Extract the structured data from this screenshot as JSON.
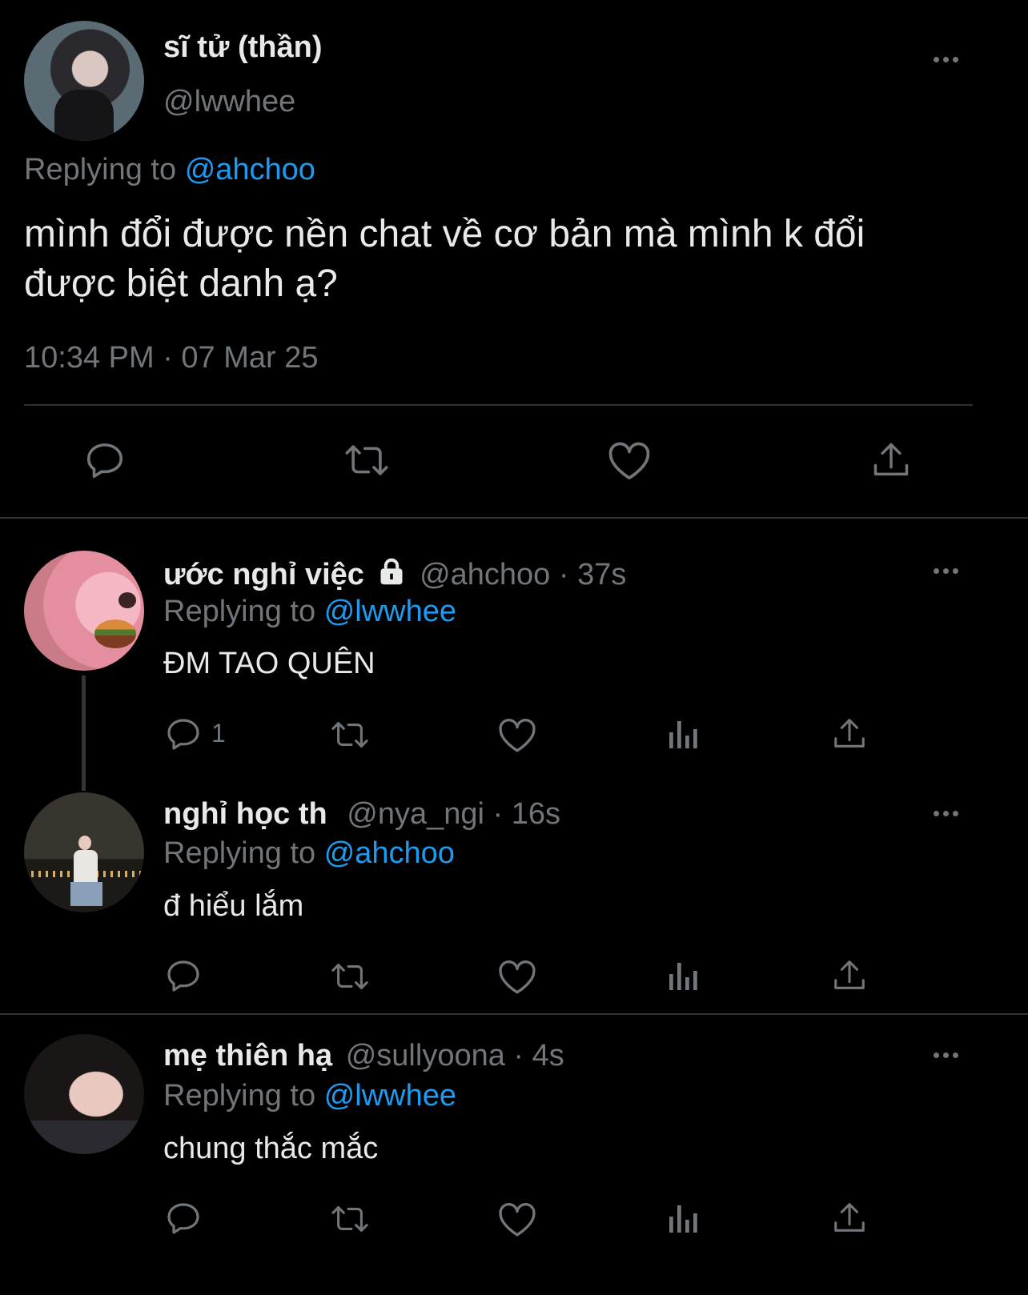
{
  "main_tweet": {
    "display_name": "sĩ tử (thần)",
    "handle": "@lwwhee",
    "replying_label": "Replying to",
    "replying_to": "@ahchoo",
    "text_line1": "mình đổi được nền chat về cơ bản mà mình k đổi",
    "text_line2": "được biệt danh ạ?",
    "timestamp": "10:34 PM · 07 Mar 25"
  },
  "replies": [
    {
      "display_name": "ước nghỉ việc",
      "handle": "@ahchoo",
      "sep": "·",
      "time": "37s",
      "replying_label": "Replying to",
      "replying_to": "@lwwhee",
      "text": "ĐM TAO QUÊN",
      "reply_count": "1"
    },
    {
      "display_name": "nghỉ học th",
      "handle": "@nya_ngi",
      "sep": "·",
      "time": "16s",
      "replying_label": "Replying to",
      "replying_to": "@ahchoo",
      "text": "đ hiểu lắm",
      "reply_count": ""
    },
    {
      "display_name": "mẹ thiên hạ",
      "handle": "@sullyoona",
      "sep": "·",
      "time": "4s",
      "replying_label": "Replying to",
      "replying_to": "@lwwhee",
      "text": "chung thắc mắc",
      "reply_count": ""
    }
  ],
  "colors": {
    "background": "#000000",
    "text": "#e7e9ea",
    "muted": "#71767b",
    "link": "#1d9bf0",
    "divider": "#2f3336"
  },
  "icons": [
    "more-icon",
    "reply-icon",
    "retweet-icon",
    "like-icon",
    "views-icon",
    "share-icon",
    "lock-icon"
  ]
}
